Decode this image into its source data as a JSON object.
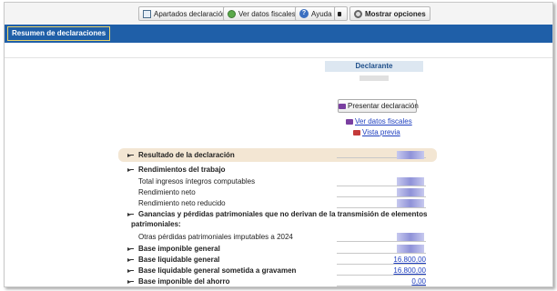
{
  "toolbar": {
    "apartados_label": "Apartados declaración",
    "ver_datos_label": "Ver datos fiscales",
    "ayuda_label": "Ayuda",
    "mostrar_label": "Mostrar opciones"
  },
  "nav": {
    "tab_label": "Resumen de declaraciones"
  },
  "declarante": {
    "header": "Declarante",
    "presentar_label": "Presentar declaración",
    "ver_datos_link": "Ver datos fiscales",
    "vista_previa_link": "Vista previa"
  },
  "rows": [
    {
      "label": "Resultado de la declaración",
      "bold": true,
      "level": 1,
      "value": "",
      "blurred": true
    },
    {
      "label": "Rendimientos del trabajo",
      "bold": true,
      "level": 1,
      "value": "",
      "blurred": false
    },
    {
      "label": "Total ingresos íntegros computables",
      "bold": false,
      "level": 2,
      "value": "",
      "blurred": true
    },
    {
      "label": "Rendimiento neto",
      "bold": false,
      "level": 2,
      "value": "",
      "blurred": true
    },
    {
      "label": "Rendimiento neto reducido",
      "bold": false,
      "level": 2,
      "value": "",
      "blurred": true
    },
    {
      "label": "Ganancias y pérdidas patrimoniales que no derivan de la transmisión de elementos",
      "label2": "patrimoniales:",
      "bold": true,
      "level": 1,
      "value": "",
      "blurred": false
    },
    {
      "label": "Otras pérdidas patrimoniales imputables a 2024",
      "bold": false,
      "level": 2,
      "value": "",
      "blurred": true
    },
    {
      "label": "Base imponible general",
      "bold": true,
      "level": 1,
      "value": "",
      "blurred": true
    },
    {
      "label": "Base liquidable general",
      "bold": true,
      "level": 1,
      "value": "16.800,00",
      "blurred": false
    },
    {
      "label": "Base liquidable general sometida a gravamen",
      "bold": true,
      "level": 1,
      "value": "16.800,00",
      "blurred": false
    },
    {
      "label": "Base imponible del ahorro",
      "bold": true,
      "level": 1,
      "value": "0,00",
      "blurred": false
    }
  ]
}
